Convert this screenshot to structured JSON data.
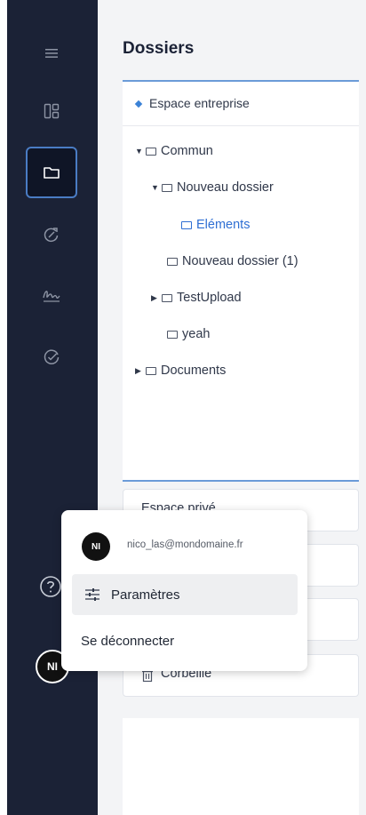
{
  "sidebar": {
    "nav": [
      {
        "name": "menu-icon",
        "active": false
      },
      {
        "name": "dashboard-icon",
        "active": false
      },
      {
        "name": "folder-icon",
        "active": true
      },
      {
        "name": "workflow-icon",
        "active": false
      },
      {
        "name": "signature-icon",
        "active": false
      },
      {
        "name": "check-circle-icon",
        "active": false
      }
    ],
    "help_icon": "help-icon",
    "avatar_initials": "NI"
  },
  "main": {
    "title": "Dossiers",
    "workspace": {
      "label": "Espace entreprise",
      "tree": [
        {
          "label": "Commun",
          "expanded": true,
          "depth": 0
        },
        {
          "label": "Nouveau dossier",
          "expanded": true,
          "depth": 1
        },
        {
          "label": "Eléments",
          "selected": true,
          "depth": 2
        },
        {
          "label": "Nouveau dossier (1)",
          "depth": 1
        },
        {
          "label": "TestUpload",
          "expanded": false,
          "depth": 1
        },
        {
          "label": "yeah",
          "depth": 1
        },
        {
          "label": "Documents",
          "expanded": false,
          "depth": 0
        }
      ]
    },
    "cards": {
      "private_space": "Espace privé",
      "trash": "Corbeille"
    }
  },
  "popup": {
    "avatar_initials": "NI",
    "email": "nico_las@mondomaine.fr",
    "settings_label": "Paramètres",
    "logout_label": "Se déconnecter"
  },
  "colors": {
    "sidebar_bg": "#1b2236",
    "accent": "#2f6fd3",
    "active_border": "#4a7cc4"
  }
}
